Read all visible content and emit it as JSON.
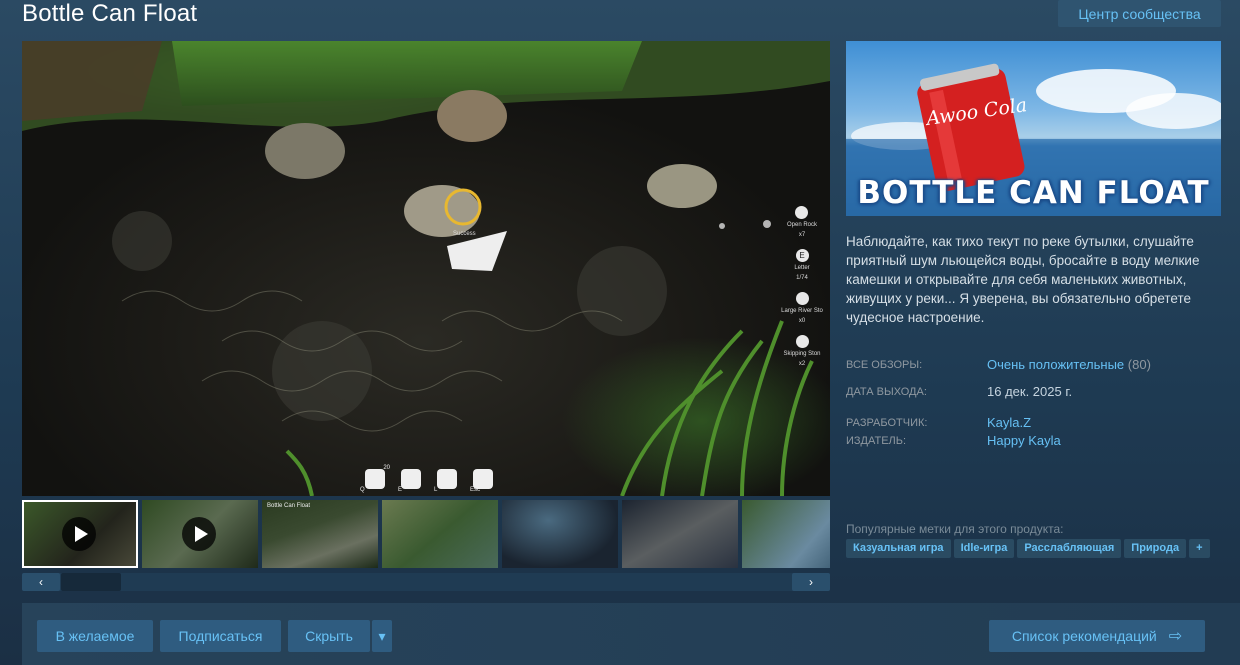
{
  "game_title": "Bottle Can Float",
  "community_hub_label": "Центр сообщества",
  "hud": {
    "success": "Success",
    "right_items": [
      {
        "icon": "open-rock-icon",
        "label": "Open Rock",
        "count": "x7"
      },
      {
        "icon": "letter-icon",
        "label": "Letter",
        "count": "1/74",
        "glyph": "E"
      },
      {
        "icon": "large-river-stone-icon",
        "label": "Large River Sto",
        "count": "x0"
      },
      {
        "icon": "skipping-stone-icon",
        "label": "Skipping Ston",
        "count": "x2"
      }
    ],
    "bottom_slots": [
      {
        "icon": "stones-icon",
        "top": "20",
        "bottom": "Q"
      },
      {
        "icon": "bag-icon",
        "bottom": "E"
      },
      {
        "icon": "notes-icon",
        "bottom": "L"
      },
      {
        "icon": "wrench-icon",
        "bottom": "Esc"
      }
    ]
  },
  "thumbnails": [
    {
      "type": "video",
      "active": true
    },
    {
      "type": "video",
      "active": false
    },
    {
      "type": "image",
      "caption": "Bottle Can Float"
    },
    {
      "type": "image"
    },
    {
      "type": "image"
    },
    {
      "type": "image"
    },
    {
      "type": "image"
    }
  ],
  "scroll": {
    "left_glyph": "‹",
    "right_glyph": "›"
  },
  "capsule": {
    "can_text": "Awoo Cola",
    "title": "BOTTLE CAN FLOAT"
  },
  "description": "Наблюдайте, как тихо текут по реке бутылки, слушайте приятный шум льющейся воды, бросайте в воду мелкие камешки и открывайте для себя маленьких животных, живущих у реки... Я уверена, вы обязательно обретете чудесное настроение.",
  "info": {
    "reviews_label": "ВСЕ ОБЗОРЫ:",
    "reviews_value": "Очень положительные",
    "reviews_count": "(80)",
    "release_label": "ДАТА ВЫХОДА:",
    "release_value": "16 дек. 2025 г.",
    "developer_label": "РАЗРАБОТЧИК:",
    "developer_value": "Kayla.Z",
    "publisher_label": "ИЗДАТЕЛЬ:",
    "publisher_value": "Happy Kayla"
  },
  "tags_label": "Популярные метки для этого продукта:",
  "tags": [
    "Казуальная игра",
    "Idle-игра",
    "Расслабляющая",
    "Природа",
    "+"
  ],
  "actions": {
    "wishlist": "В желаемое",
    "follow": "Подписаться",
    "hide": "Скрыть",
    "dropdown_glyph": "▾",
    "queue": "Список рекомендаций",
    "queue_glyph": "⇨"
  },
  "colors": {
    "accent": "#66c0f4",
    "button_bg": "#2f5c80",
    "bg": "#1e3a52"
  }
}
